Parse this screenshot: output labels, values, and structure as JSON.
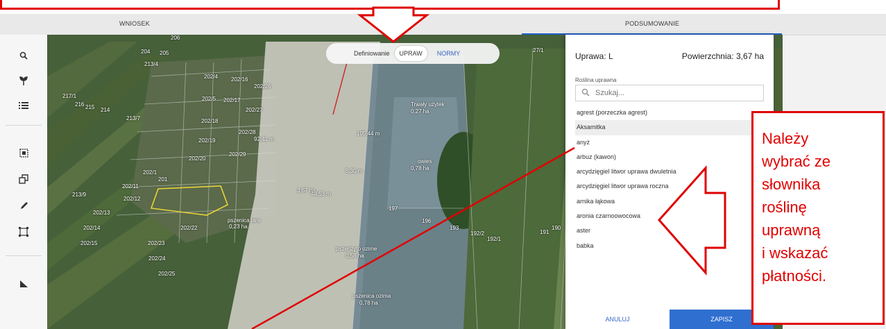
{
  "tabs": {
    "left": "WNIOSEK",
    "right": "PODSUMOWANIE"
  },
  "mode_pill": {
    "label": "Definiowanie",
    "active": "UPRAW",
    "inactive": "NORMY"
  },
  "panel": {
    "title": "Uprawa: L",
    "area": "Powierzchnia: 3,67 ha",
    "field_label": "Roślina uprawna",
    "search_placeholder": "Szukaj...",
    "items": [
      "agrest (porzeczka agrest)",
      "Aksamitka",
      "anyż",
      "arbuz (kawon)",
      "arcydzięgiel litwor uprawa dwuletnia",
      "arcydzięgiel litwor uprawa roczna",
      "arnika łąkowa",
      "aronia czarnoowocowa",
      "aster",
      "babka"
    ],
    "cancel": "ANULUJ",
    "save": "ZAPISZ"
  },
  "callout": {
    "lines": [
      "Należy",
      "wybrać ze",
      "słownika",
      "roślinę",
      "uprawną",
      "i wskazać",
      "płatności."
    ]
  },
  "map_labels": {
    "l1": "206",
    "l2": "205",
    "l3": "204",
    "l4": "213/4",
    "l5": "202/4",
    "l6": "202/16",
    "l7": "202/26",
    "l8": "217/1",
    "l9": "216",
    "l10": "215",
    "l11": "214",
    "l12": "213/7",
    "l13": "202/5",
    "l14": "202/17",
    "l15": "202/27",
    "l16": "202/18",
    "l17": "202/28",
    "l18": "202/19",
    "l19": "202/20",
    "l20": "202/29",
    "l21": "202/1",
    "l22": "201",
    "l23": "202/11",
    "l24": "202/12",
    "l25": "213/9",
    "l26": "202/13",
    "l27": "202/14",
    "l28": "202/15",
    "l29": "202/22",
    "l30": "202/23",
    "l31": "202/24",
    "l32": "202/25",
    "l33": "197",
    "l34": "196",
    "l35": "193",
    "l36": "192/2",
    "l37": "192/1",
    "l38": "191",
    "l39": "190",
    "l40": "27/1",
    "l41": "3,67 ha",
    "l42": "owies",
    "l43": "0,78 ha",
    "l44": "pszenica jara",
    "l45": "0,23 ha",
    "l46": "pszenżyto ozime",
    "l47": "0,58 ha",
    "l48": "pszenica ozima",
    "l49": "0,78 ha",
    "l50": "105,44 m",
    "l51": "92,41 m",
    "l52": "48,53 m",
    "l53": "5,30 m",
    "l54": "Trwały użytek",
    "l55": "0,27 ha"
  },
  "colors": {
    "accent": "#2f6fd0",
    "callout": "#e00000"
  }
}
